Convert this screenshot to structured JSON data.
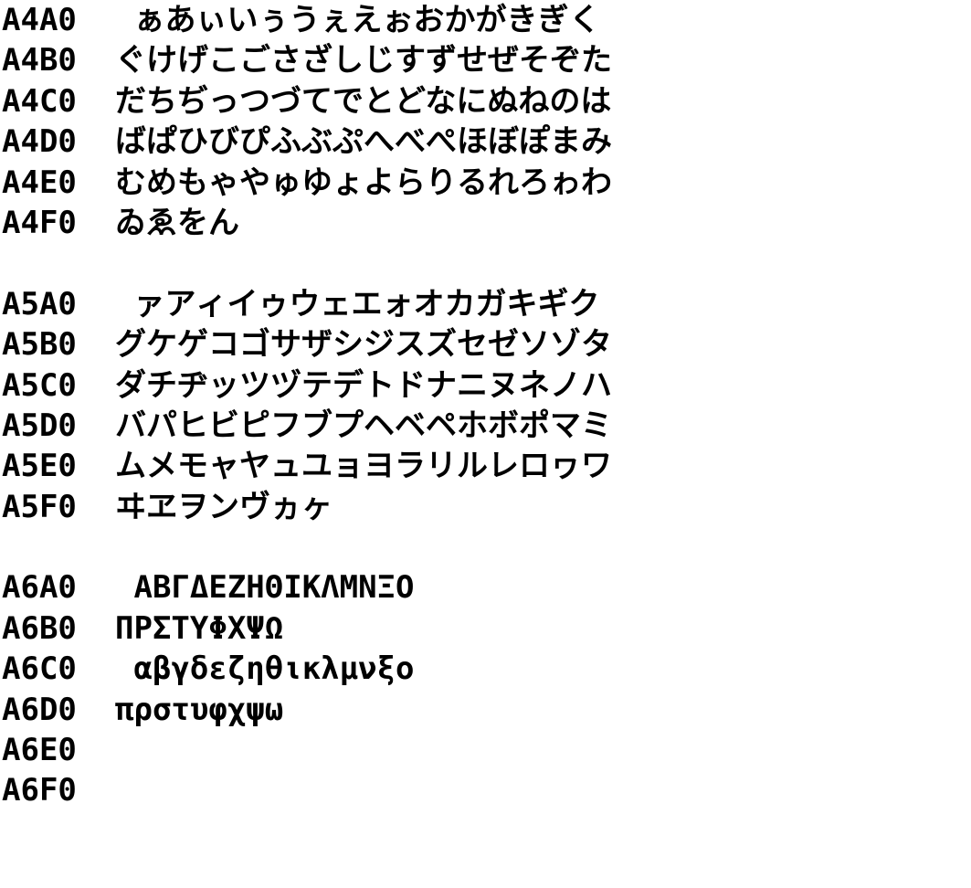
{
  "sections": [
    {
      "rows": [
        {
          "code": "A4A0",
          "chars": " ぁあぃいぅうぇえぉおかがきぎく"
        },
        {
          "code": "A4B0",
          "chars": "ぐけげこごさざしじすずせぜそぞた"
        },
        {
          "code": "A4C0",
          "chars": "だちぢっつづてでとどなにぬねのは"
        },
        {
          "code": "A4D0",
          "chars": "ばぱひびぴふぶぷへべぺほぼぽまみ"
        },
        {
          "code": "A4E0",
          "chars": "むめもゃやゅゆょよらりるれろゎわ"
        },
        {
          "code": "A4F0",
          "chars": "ゐゑをん"
        }
      ]
    },
    {
      "rows": [
        {
          "code": "A5A0",
          "chars": " ァアィイゥウェエォオカガキギク"
        },
        {
          "code": "A5B0",
          "chars": "グケゲコゴサザシジスズセゼソゾタ"
        },
        {
          "code": "A5C0",
          "chars": "ダチヂッツヅテデトドナニヌネノハ"
        },
        {
          "code": "A5D0",
          "chars": "バパヒビピフブプヘベペホボポマミ"
        },
        {
          "code": "A5E0",
          "chars": "ムメモャヤュユョヨラリルレロヮワ"
        },
        {
          "code": "A5F0",
          "chars": "ヰヱヲンヴヵヶ"
        }
      ]
    },
    {
      "rows": [
        {
          "code": "A6A0",
          "chars": " ΑΒΓΔΕΖΗΘΙΚΛΜΝΞΟ"
        },
        {
          "code": "A6B0",
          "chars": "ΠΡΣΤΥΦΧΨΩ"
        },
        {
          "code": "A6C0",
          "chars": " αβγδεζηθικλμνξο"
        },
        {
          "code": "A6D0",
          "chars": "πρστυφχψω"
        },
        {
          "code": "A6E0",
          "chars": ""
        },
        {
          "code": "A6F0",
          "chars": ""
        }
      ]
    }
  ]
}
